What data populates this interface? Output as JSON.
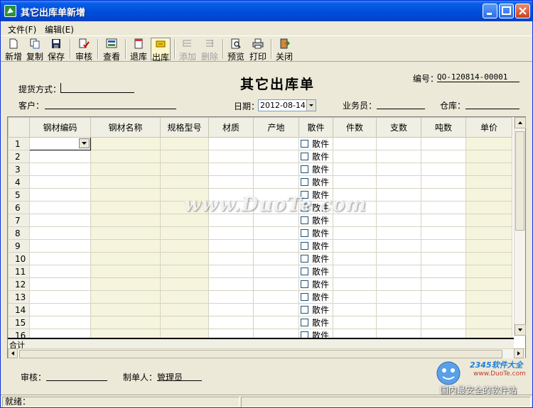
{
  "window": {
    "title": "其它出库单新增"
  },
  "menu": {
    "file": "文件(F)",
    "edit": "编辑(E)"
  },
  "toolbar": {
    "new": "新增",
    "copy": "复制",
    "save": "保存",
    "audit": "审核",
    "view": "查看",
    "return_stock": "退库",
    "out_stock": "出库",
    "add_row": "添加",
    "delete_row": "删除",
    "preview": "预览",
    "print": "打印",
    "close": "关闭"
  },
  "form": {
    "title": "其它出库单",
    "number_label": "编号：",
    "number_value": "QO-120814-00001",
    "delivery_label": "提货方式：",
    "delivery_value": "",
    "customer_label": "客户：",
    "customer_value": "",
    "date_label": "日期：",
    "date_value": "2012-08-14",
    "salesman_label": "业务员：",
    "salesman_value": "",
    "warehouse_label": "仓库：",
    "warehouse_value": ""
  },
  "grid": {
    "columns": [
      "钢材编码",
      "钢材名称",
      "规格型号",
      "材质",
      "产地",
      "散件",
      "件数",
      "支数",
      "吨数",
      "单价"
    ],
    "rows": [
      "1",
      "2",
      "3",
      "4",
      "5",
      "6",
      "7",
      "8",
      "9",
      "10",
      "11",
      "12",
      "13",
      "14",
      "15",
      "16"
    ],
    "loose_label": "散件",
    "total_label": "合计"
  },
  "footer": {
    "auditor_label": "审核：",
    "auditor_value": "",
    "maker_label": "制单人：",
    "maker_value": "管理员"
  },
  "status": {
    "text": "就绪："
  },
  "watermark": {
    "text": "www.DuoTe.com"
  },
  "brand": {
    "name": "2345软件大全",
    "url": "www.DuoTe.com",
    "slogan": "国内最安全的软件站"
  }
}
